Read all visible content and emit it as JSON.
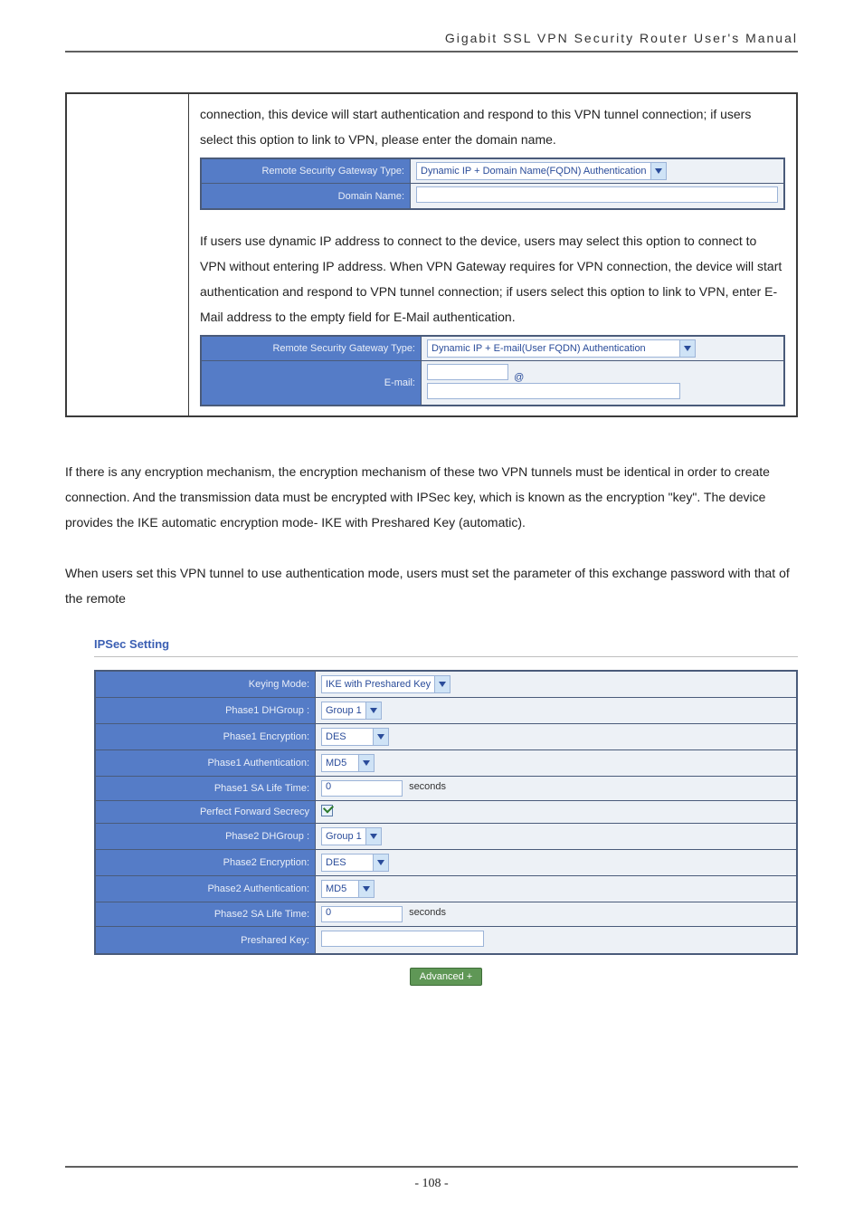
{
  "header": {
    "doc_title": "Gigabit SSL VPN Security Router User's Manual"
  },
  "box": {
    "para1": "connection, this device will start authentication and respond to this VPN tunnel connection; if users select this option to link to VPN, please enter the domain name.",
    "cfg1": {
      "row1_label": "Remote Security Gateway Type:",
      "row1_value": "Dynamic IP + Domain Name(FQDN) Authentication",
      "row2_label": "Domain Name:",
      "row2_value": ""
    },
    "para2": "If users use dynamic IP address to connect to the device, users may select this option to connect to VPN without entering IP address. When VPN Gateway requires for VPN connection, the device will start authentication and respond to VPN tunnel connection; if users select this option to link to VPN, enter E-Mail address to the empty field for E-Mail authentication.",
    "cfg2": {
      "row1_label": "Remote Security Gateway Type:",
      "row1_value": "Dynamic IP + E-mail(User FQDN) Authentication",
      "row2_label": "E-mail:",
      "row2_left": "",
      "row2_at": "@",
      "row2_right": ""
    }
  },
  "body": {
    "para1": "If there is any encryption mechanism, the encryption mechanism of these two VPN tunnels must be identical in order to create connection. And the transmission data must be encrypted with IPSec key, which is known as the encryption \"key\". The device provides the IKE automatic encryption mode- IKE with Preshared Key (automatic).",
    "para2": "When users set this VPN tunnel to use authentication mode, users must set the parameter of this exchange password with that of the remote"
  },
  "ipsec": {
    "heading": "IPSec Setting",
    "rows": {
      "keying_mode_label": "Keying Mode:",
      "keying_mode_value": "IKE with Preshared Key",
      "p1dh_label": "Phase1 DHGroup :",
      "p1dh_value": "Group 1",
      "p1enc_label": "Phase1 Encryption:",
      "p1enc_value": "DES",
      "p1auth_label": "Phase1 Authentication:",
      "p1auth_value": "MD5",
      "p1sa_label": "Phase1 SA Life Time:",
      "p1sa_value": "0",
      "p1sa_unit": "seconds",
      "pfs_label": "Perfect Forward Secrecy",
      "p2dh_label": "Phase2 DHGroup :",
      "p2dh_value": "Group 1",
      "p2enc_label": "Phase2 Encryption:",
      "p2enc_value": "DES",
      "p2auth_label": "Phase2 Authentication:",
      "p2auth_value": "MD5",
      "p2sa_label": "Phase2 SA Life Time:",
      "p2sa_value": "0",
      "p2sa_unit": "seconds",
      "pre_label": "Preshared Key:",
      "pre_value": ""
    },
    "advanced_btn": "Advanced +"
  },
  "footer": {
    "page_number": "- 108 -"
  }
}
